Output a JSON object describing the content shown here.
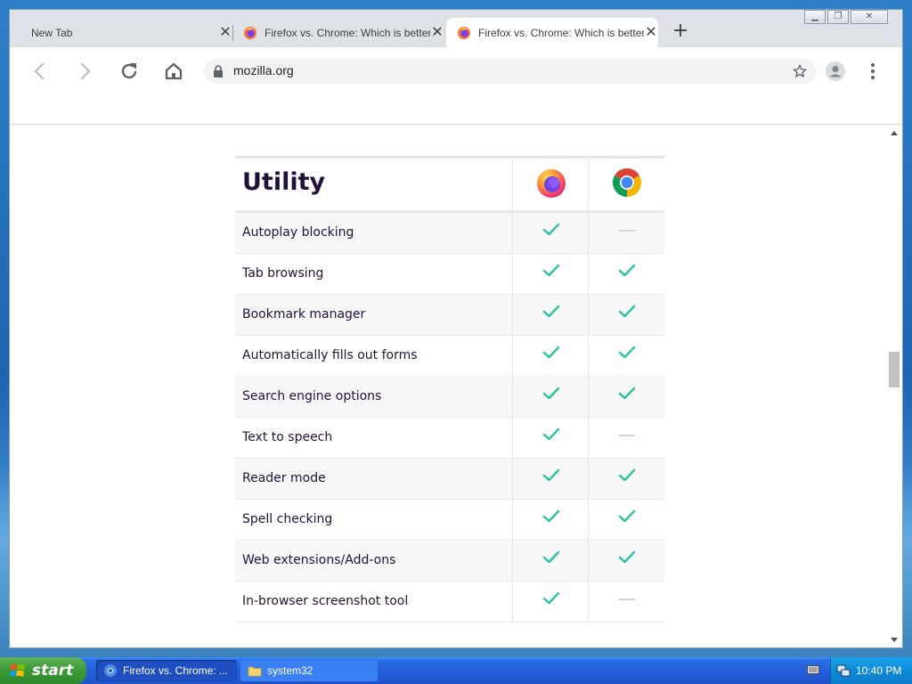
{
  "browser": {
    "tabs": [
      {
        "title": "New Tab",
        "active": false
      },
      {
        "title": "Firefox vs. Chrome: Which is better?",
        "active": false
      },
      {
        "title": "Firefox vs. Chrome: Which is better?",
        "active": true
      }
    ],
    "new_tab_symbol": "+",
    "url": "mozilla.org",
    "icons": [
      "back-arrow",
      "forward-arrow",
      "reload",
      "home",
      "lock",
      "star",
      "profile",
      "kebab-menu"
    ]
  },
  "comparison": {
    "section_title": "Utility",
    "columns": [
      "firefox-logo",
      "chrome-logo"
    ],
    "rows": [
      {
        "feature": "Autoplay blocking",
        "firefox": true,
        "chrome": false
      },
      {
        "feature": "Tab browsing",
        "firefox": true,
        "chrome": true
      },
      {
        "feature": "Bookmark manager",
        "firefox": true,
        "chrome": true
      },
      {
        "feature": "Automatically fills out forms",
        "firefox": true,
        "chrome": true
      },
      {
        "feature": "Search engine options",
        "firefox": true,
        "chrome": true
      },
      {
        "feature": "Text to speech",
        "firefox": true,
        "chrome": false
      },
      {
        "feature": "Reader mode",
        "firefox": true,
        "chrome": true
      },
      {
        "feature": "Spell checking",
        "firefox": true,
        "chrome": true
      },
      {
        "feature": "Web extensions/Add-ons",
        "firefox": true,
        "chrome": true
      },
      {
        "feature": "In-browser screenshot tool",
        "firefox": true,
        "chrome": false
      }
    ],
    "check_color": "#2ac3a2",
    "dash_color": "#d4d4d4"
  },
  "taskbar": {
    "start_label": "start",
    "tasks": [
      {
        "label": "Firefox vs. Chrome: ...",
        "icon": "chrome-icon",
        "active": true
      },
      {
        "label": "system32",
        "icon": "folder-icon",
        "active": false
      }
    ],
    "clock": "10:40 PM"
  }
}
